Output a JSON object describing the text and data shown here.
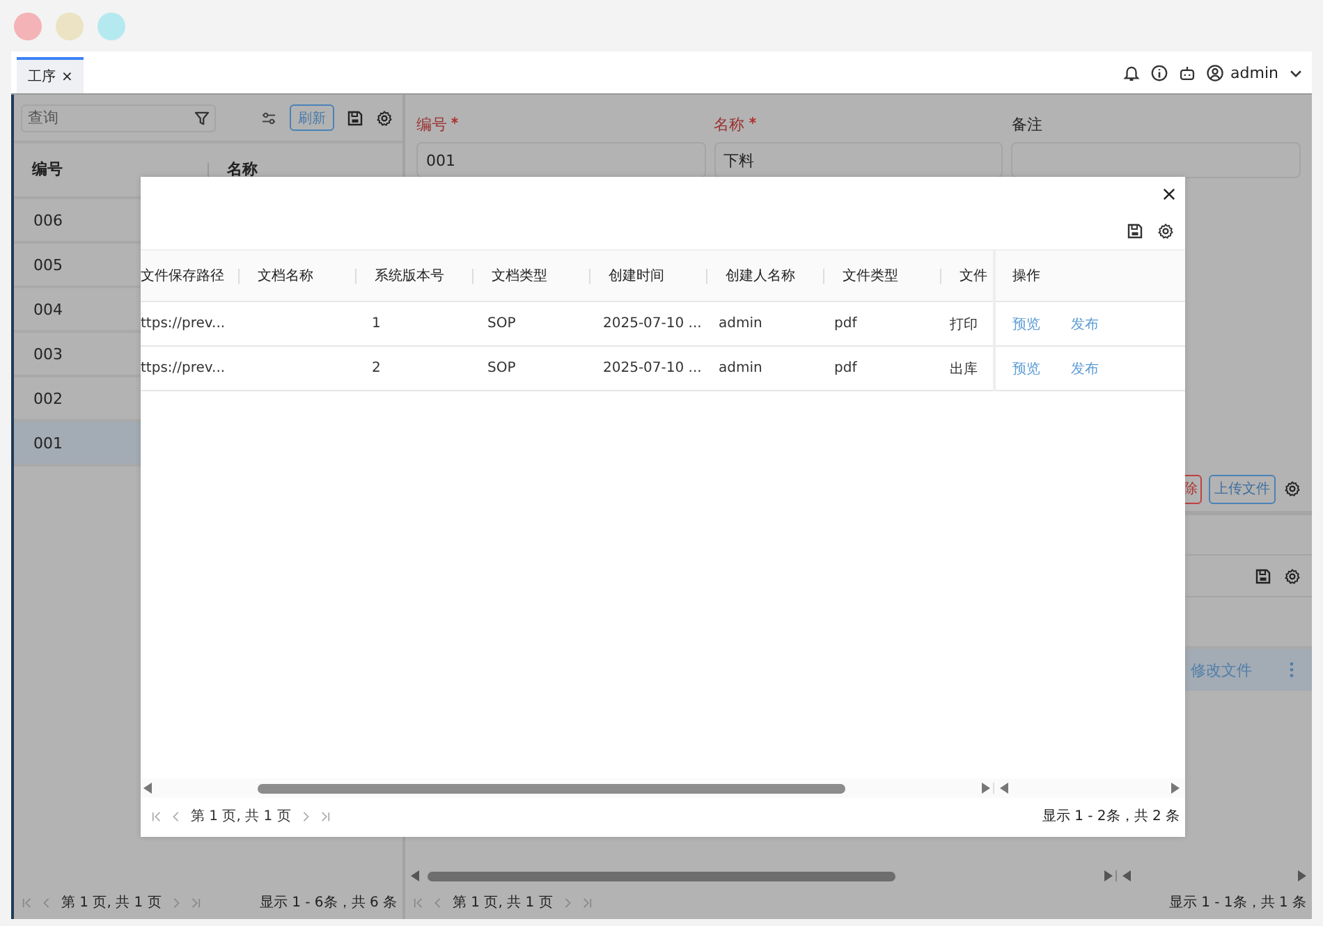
{
  "window_controls": [
    {
      "color": "#f4b3b6"
    },
    {
      "color": "#ebe3c3"
    },
    {
      "color": "#b5e9f0"
    }
  ],
  "header": {
    "tabs": [
      {
        "label": "工序",
        "selected": true,
        "close": "×"
      }
    ],
    "user": "admin"
  },
  "left_panel": {
    "search": {
      "placeholder": "查询"
    },
    "refresh_button": "刷新",
    "columns": [
      "编号",
      "名称"
    ],
    "rows": [
      {
        "code": "006",
        "selected": false
      },
      {
        "code": "005",
        "selected": false
      },
      {
        "code": "004",
        "selected": false
      },
      {
        "code": "003",
        "selected": false
      },
      {
        "code": "002",
        "selected": false
      },
      {
        "code": "001",
        "selected": true
      }
    ],
    "pager": {
      "page_text": "第 1 页, 共 1 页",
      "summary": "显示 1 - 6条，共 6 条"
    }
  },
  "form": {
    "fields": [
      {
        "label": "编号",
        "required": true,
        "value": "001"
      },
      {
        "label": "名称",
        "required": true,
        "value": "下料"
      },
      {
        "label": "备注",
        "required": false
      }
    ]
  },
  "file_panel": {
    "delete_button": "除",
    "upload_button": "上传文件",
    "rows": [
      {
        "action": "修改文件",
        "selected": true
      }
    ],
    "pager": {
      "page_text": "第 1 页, 共 1 页",
      "summary": "显示 1 - 1条，共 1 条"
    }
  },
  "modal": {
    "columns": [
      "文件保存路径",
      "文档名称",
      "系统版本号",
      "文档类型",
      "创建时间",
      "创建人名称",
      "文件类型",
      "文件"
    ],
    "action_column": "操作",
    "rows": [
      {
        "cells": [
          "ttps://prev...",
          "",
          "1",
          "SOP",
          "2025-07-10 ...",
          "admin",
          "pdf",
          "打印"
        ],
        "actions": [
          "预览",
          "发布"
        ]
      },
      {
        "cells": [
          "ttps://prev...",
          "",
          "2",
          "SOP",
          "2025-07-10 ...",
          "admin",
          "pdf",
          "出库"
        ],
        "actions": [
          "预览",
          "发布"
        ]
      }
    ],
    "pager": {
      "page_text": "第 1 页, 共 1 页",
      "summary": "显示 1 - 2条，共 2 条"
    }
  }
}
